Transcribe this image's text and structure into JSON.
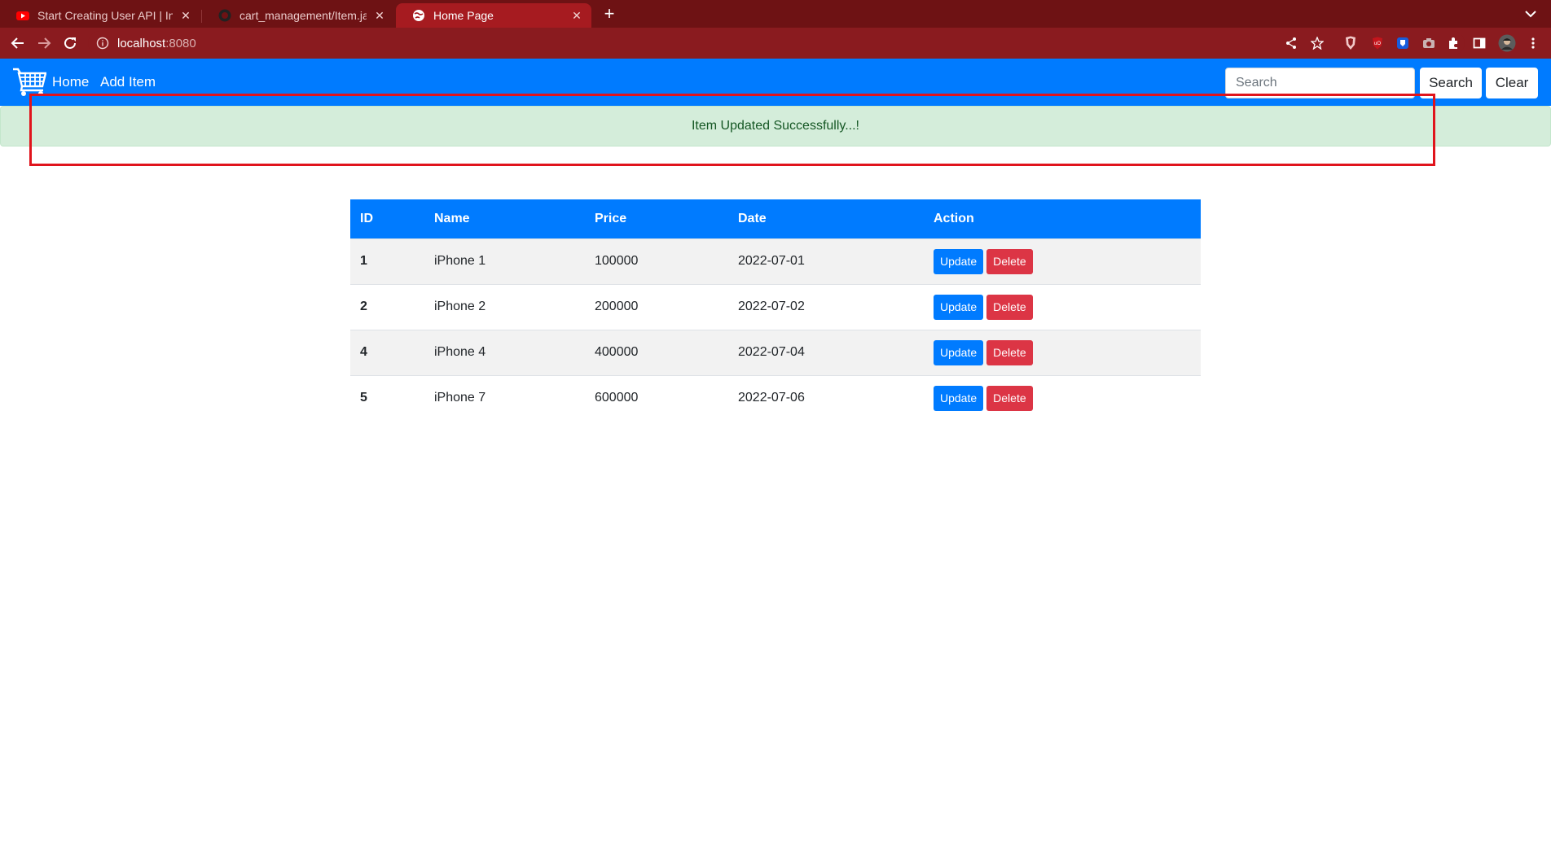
{
  "browser": {
    "tabs": [
      {
        "title": "Start Creating User API | Inst",
        "favicon": "youtube-icon",
        "active": false
      },
      {
        "title": "cart_management/Item.java",
        "favicon": "github-icon",
        "active": false
      },
      {
        "title": "Home Page",
        "favicon": "globe-icon",
        "active": true
      }
    ],
    "url": {
      "host": "localhost",
      "port": ":8080"
    },
    "toolbar_icons": [
      "share-icon",
      "star-icon",
      "brave-shield-icon",
      "ublock-icon",
      "bitwarden-icon",
      "camera-icon",
      "extensions-icon",
      "sidebar-icon",
      "profile-avatar",
      "menu-icon"
    ]
  },
  "navbar": {
    "brand_icon": "cart-icon",
    "links": {
      "home": "Home",
      "add_item": "Add Item"
    },
    "search": {
      "placeholder": "Search",
      "value": ""
    },
    "search_button": "Search",
    "clear_button": "Clear",
    "bg_color": "#007bff"
  },
  "alert": {
    "message": "Item Updated Successfully...!",
    "color": "#155724",
    "bg_color": "#d4edda"
  },
  "table": {
    "headers": [
      "ID",
      "Name",
      "Price",
      "Date",
      "Action"
    ],
    "rows": [
      {
        "id": "1",
        "name": "iPhone 1",
        "price": "100000",
        "date": "2022-07-01"
      },
      {
        "id": "2",
        "name": "iPhone 2",
        "price": "200000",
        "date": "2022-07-02"
      },
      {
        "id": "4",
        "name": "iPhone 4",
        "price": "400000",
        "date": "2022-07-04"
      },
      {
        "id": "5",
        "name": "iPhone 7",
        "price": "600000",
        "date": "2022-07-06"
      }
    ],
    "update_label": "Update",
    "delete_label": "Delete",
    "update_color": "#007bff",
    "delete_color": "#dc3545"
  }
}
